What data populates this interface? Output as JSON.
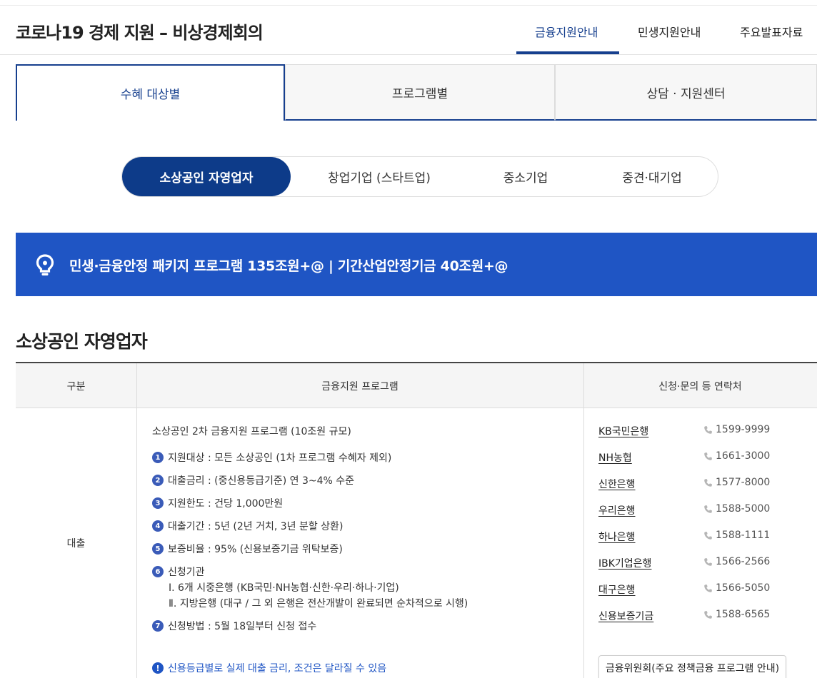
{
  "header": {
    "title": "코로나19 경제 지원 – 비상경제회의",
    "nav": [
      "금융지원안내",
      "민생지원안내",
      "주요발표자료"
    ]
  },
  "big_tabs": [
    "수혜 대상별",
    "프로그램별",
    "상담 · 지원센터"
  ],
  "pill_tabs": [
    "소상공인 자영업자",
    "창업기업 (스타트업)",
    "중소기업",
    "중견·대기업"
  ],
  "banner": {
    "text": "민생·금융안정 패키지 프로그램 135조원+@  |  기간산업안정기금 40조원+@"
  },
  "section_title": "소상공인 자영업자",
  "table": {
    "headers": [
      "구분",
      "금융지원 프로그램",
      "신청·문의 등 연락처"
    ],
    "category": "대출",
    "program_title": "소상공인 2차 금융지원 프로그램 (10조원 규모)",
    "items": [
      {
        "num": "1",
        "text": "지원대상 : 모든 소상공인 (1차 프로그램 수혜자 제외)"
      },
      {
        "num": "2",
        "text": "대출금리 : (중신용등급기준) 연 3~4% 수준"
      },
      {
        "num": "3",
        "text": "지원한도 : 건당 1,000만원"
      },
      {
        "num": "4",
        "text": "대출기간 : 5년 (2년 거치, 3년 분할 상환)"
      },
      {
        "num": "5",
        "text": "보증비율 : 95% (신용보증기금 위탁보증)"
      },
      {
        "num": "6",
        "text": "신청기관"
      },
      {
        "num": "7",
        "text": "신청방법 : 5월 18일부터 신청 접수"
      }
    ],
    "sub_lines": [
      "Ⅰ. 6개 시중은행 (KB국민·NH농협·신한·우리·하나·기업)",
      "Ⅱ. 지방은행 (대구 / 그 외 은행은 전산개발이 완료되면 순차적으로 시행)"
    ],
    "notice": "신용등급별로 실제 대출 금리, 조건은 달라질 수 있음",
    "contacts": [
      {
        "name": "KB국민은행",
        "phone": "1599-9999"
      },
      {
        "name": "NH농협",
        "phone": "1661-3000"
      },
      {
        "name": "신한은행",
        "phone": "1577-8000"
      },
      {
        "name": "우리은행",
        "phone": "1588-5000"
      },
      {
        "name": "하나은행",
        "phone": "1588-1111"
      },
      {
        "name": "IBK기업은행",
        "phone": "1566-2566"
      },
      {
        "name": "대구은행",
        "phone": "1566-5050"
      },
      {
        "name": "신용보증기금",
        "phone": "1588-6565"
      }
    ],
    "fsc_button": "금융위원회(주요 정책금융 프로그램 안내)"
  },
  "colors": {
    "primary": "#163f8e",
    "pill_active": "#0d3b89",
    "banner": "#1f55c4",
    "number_badge": "#3a5bb8"
  }
}
